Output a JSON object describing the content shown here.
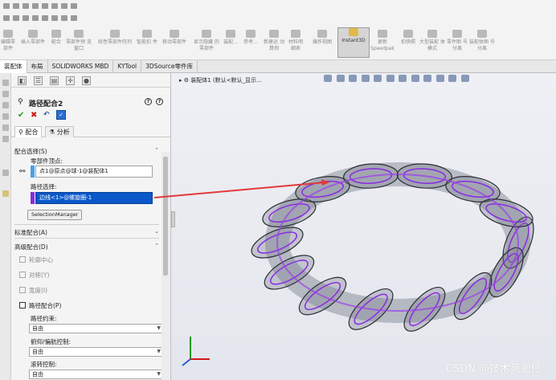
{
  "ribbon": {
    "items": [
      {
        "label": "编辑零\n部件"
      },
      {
        "label": "插入零部件"
      },
      {
        "label": "配合"
      },
      {
        "label": "零部件预\n览窗口"
      },
      {
        "label": "线性零部件阵列"
      },
      {
        "label": "智能扣\n件"
      },
      {
        "label": "移动零部件"
      },
      {
        "label": "显示隐藏\n的零部件"
      },
      {
        "label": "装配..."
      },
      {
        "label": "参考..."
      },
      {
        "label": "新建运\n动算例"
      },
      {
        "label": "材料明\n细表"
      },
      {
        "label": "爆炸视图"
      },
      {
        "label": "Instant3D"
      },
      {
        "label": "更新\nSpeedpak"
      },
      {
        "label": "拍快照"
      },
      {
        "label": "大型装配\n体模式"
      },
      {
        "label": "零件图\n号分离"
      },
      {
        "label": "装配体图\n号分离"
      }
    ]
  },
  "tabs": [
    "装配体",
    "布局",
    "SOLIDWORKS MBD",
    "KYTool",
    "3DSource零件库"
  ],
  "pm": {
    "title": "路径配合2",
    "subtab_mate": "配合",
    "subtab_analysis": "分析",
    "section_selection": "配合选择(S)",
    "label_vertex": "零部件顶点:",
    "vertex_value": "点1@原点@球-1@装配体1",
    "label_path": "路径选择:",
    "path_value": "边线<1>@螺旋圈-1",
    "selection_manager": "SelectionManager",
    "section_standard": "标准配合(A)",
    "section_advanced": "高级配合(D)",
    "adv_items": [
      "轮廓中心",
      "对称(Y)",
      "宽度(I)",
      "路径配合(P)"
    ],
    "label_constraint": "路径约束:",
    "constraint_value": "自由",
    "label_pitch": "俯仰/偏航控制:",
    "pitch_value": "自由",
    "label_roll": "滚转控制:",
    "roll_value": "自由"
  },
  "view": {
    "breadcrumb": "装配体1 (默认<默认_显示...",
    "watermark": "CSDN @技术死肥仔"
  },
  "colors": {
    "accent_blue": "#0a58c9",
    "arrow_red": "#e23a3a",
    "coil_purple": "#8a2be2"
  }
}
